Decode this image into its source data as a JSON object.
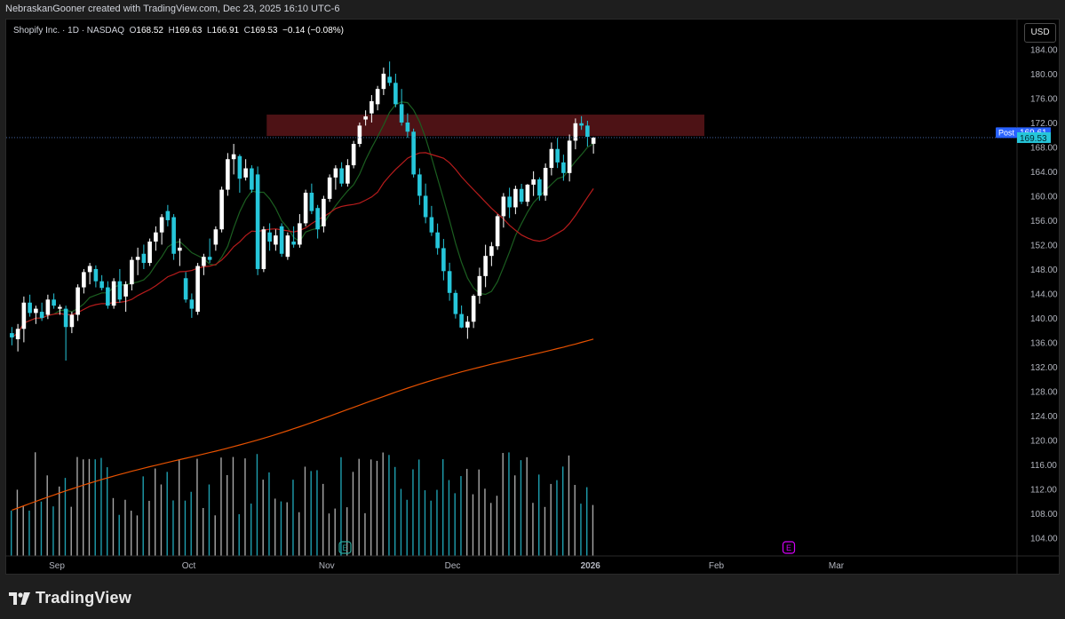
{
  "header": {
    "attribution": "NebraskanGooner created with TradingView.com, Dec 23, 2025 16:10 UTC-6"
  },
  "legend": {
    "symbol": "Shopify Inc. · 1D · NASDAQ",
    "o_label": "O",
    "o_value": "168.52",
    "h_label": "H",
    "h_value": "169.63",
    "l_label": "L",
    "l_value": "166.91",
    "c_label": "C",
    "c_value": "169.53",
    "change": "−0.14 (−0.08%)"
  },
  "toolbar": {
    "currency": "USD"
  },
  "price_badges": {
    "post_label": "Post",
    "post_value": "169.61",
    "last_value": "169.53"
  },
  "footer": {
    "brand": "TradingView"
  },
  "colors": {
    "up": "#ffffff",
    "down": "#26c6da",
    "ema_short": "#1b5e20",
    "ema_mid": "#b71c1c",
    "sma_long": "#e65100",
    "zone": "#5a1519",
    "post_badge": "#2962ff",
    "last_badge": "#26c6da",
    "earnings_icon": "#d500f9"
  },
  "chart_data": {
    "type": "candlestick",
    "symbol": "Shopify Inc.",
    "interval": "1D",
    "exchange": "NASDAQ",
    "currency": "USD",
    "ylim": [
      101,
      188
    ],
    "y_ticks": [
      184,
      180,
      176,
      172,
      168,
      164,
      160,
      156,
      152,
      148,
      144,
      140,
      136,
      132,
      128,
      124,
      120,
      116,
      112,
      108,
      104
    ],
    "x_axis_labels": [
      {
        "label": "Sep",
        "index": 8
      },
      {
        "label": "Oct",
        "index": 30
      },
      {
        "label": "Nov",
        "index": 53
      },
      {
        "label": "Dec",
        "index": 74
      },
      {
        "label": "2026",
        "index": 97
      },
      {
        "label": "Feb",
        "index": 118
      },
      {
        "label": "Mar",
        "index": 138
      }
    ],
    "x_count": 146,
    "grid": false,
    "resistance_zone": {
      "from_index": 43,
      "to_index": 116,
      "low": 169.8,
      "high": 173.3
    },
    "post_market_price": 169.61,
    "last_price": 169.53,
    "earnings_markers": [
      56,
      130
    ],
    "candles": [
      {
        "o": 137.5,
        "h": 138.5,
        "l": 135.5,
        "c": 136.8
      },
      {
        "o": 136.5,
        "h": 139.0,
        "l": 134.5,
        "c": 138.2
      },
      {
        "o": 138.2,
        "h": 143.5,
        "l": 136.0,
        "c": 142.5
      },
      {
        "o": 142.5,
        "h": 143.8,
        "l": 140.2,
        "c": 140.8
      },
      {
        "o": 140.8,
        "h": 142.0,
        "l": 139.0,
        "c": 141.5
      },
      {
        "o": 141.0,
        "h": 142.5,
        "l": 139.5,
        "c": 140.0
      },
      {
        "o": 140.5,
        "h": 143.8,
        "l": 139.8,
        "c": 143.0
      },
      {
        "o": 143.0,
        "h": 144.0,
        "l": 141.5,
        "c": 142.0
      },
      {
        "o": 141.5,
        "h": 142.2,
        "l": 140.5,
        "c": 141.8
      },
      {
        "o": 141.5,
        "h": 142.0,
        "l": 133.0,
        "c": 138.5
      },
      {
        "o": 138.5,
        "h": 141.0,
        "l": 137.5,
        "c": 140.5
      },
      {
        "o": 140.5,
        "h": 145.5,
        "l": 139.5,
        "c": 145.0
      },
      {
        "o": 145.0,
        "h": 148.0,
        "l": 144.0,
        "c": 147.5
      },
      {
        "o": 147.5,
        "h": 149.0,
        "l": 145.5,
        "c": 148.5
      },
      {
        "o": 148.0,
        "h": 148.6,
        "l": 145.0,
        "c": 146.0
      },
      {
        "o": 146.0,
        "h": 147.0,
        "l": 144.5,
        "c": 144.9
      },
      {
        "o": 145.0,
        "h": 146.0,
        "l": 141.5,
        "c": 142.0
      },
      {
        "o": 142.0,
        "h": 146.5,
        "l": 141.5,
        "c": 146.0
      },
      {
        "o": 146.0,
        "h": 148.0,
        "l": 142.5,
        "c": 143.0
      },
      {
        "o": 143.5,
        "h": 146.0,
        "l": 141.0,
        "c": 145.5
      },
      {
        "o": 145.5,
        "h": 150.0,
        "l": 144.5,
        "c": 149.5
      },
      {
        "o": 149.5,
        "h": 151.5,
        "l": 147.0,
        "c": 150.0
      },
      {
        "o": 150.5,
        "h": 152.0,
        "l": 148.0,
        "c": 149.0
      },
      {
        "o": 149.0,
        "h": 153.0,
        "l": 148.5,
        "c": 152.5
      },
      {
        "o": 152.5,
        "h": 155.0,
        "l": 151.0,
        "c": 154.0
      },
      {
        "o": 154.0,
        "h": 157.0,
        "l": 152.0,
        "c": 156.5
      },
      {
        "o": 157.5,
        "h": 158.5,
        "l": 155.0,
        "c": 156.0
      },
      {
        "o": 156.5,
        "h": 157.0,
        "l": 149.5,
        "c": 150.5
      },
      {
        "o": 151.0,
        "h": 153.0,
        "l": 148.5,
        "c": 151.5
      },
      {
        "o": 146.5,
        "h": 147.5,
        "l": 142.5,
        "c": 143.0
      },
      {
        "o": 143.0,
        "h": 144.0,
        "l": 140.0,
        "c": 141.5
      },
      {
        "o": 141.0,
        "h": 149.0,
        "l": 140.5,
        "c": 148.5
      },
      {
        "o": 148.5,
        "h": 150.5,
        "l": 147.0,
        "c": 150.0
      },
      {
        "o": 150.0,
        "h": 153.0,
        "l": 149.0,
        "c": 149.5
      },
      {
        "o": 152.0,
        "h": 155.0,
        "l": 151.0,
        "c": 154.5
      },
      {
        "o": 154.5,
        "h": 161.5,
        "l": 154.0,
        "c": 161.0
      },
      {
        "o": 161.0,
        "h": 167.0,
        "l": 160.0,
        "c": 166.0
      },
      {
        "o": 166.0,
        "h": 168.5,
        "l": 163.5,
        "c": 166.8
      },
      {
        "o": 166.5,
        "h": 166.8,
        "l": 160.5,
        "c": 162.8
      },
      {
        "o": 163.0,
        "h": 166.0,
        "l": 162.5,
        "c": 164.5
      },
      {
        "o": 164.5,
        "h": 165.0,
        "l": 160.5,
        "c": 161.0
      },
      {
        "o": 163.5,
        "h": 164.8,
        "l": 147.0,
        "c": 148.0
      },
      {
        "o": 148.0,
        "h": 155.0,
        "l": 147.5,
        "c": 154.5
      },
      {
        "o": 154.0,
        "h": 155.5,
        "l": 151.0,
        "c": 152.5
      },
      {
        "o": 152.0,
        "h": 154.5,
        "l": 151.0,
        "c": 153.5
      },
      {
        "o": 155.0,
        "h": 155.5,
        "l": 150.0,
        "c": 150.5
      },
      {
        "o": 150.0,
        "h": 154.0,
        "l": 149.5,
        "c": 153.5
      },
      {
        "o": 152.5,
        "h": 155.0,
        "l": 151.5,
        "c": 152.0
      },
      {
        "o": 152.0,
        "h": 157.0,
        "l": 151.5,
        "c": 155.5
      },
      {
        "o": 155.5,
        "h": 161.0,
        "l": 155.0,
        "c": 160.5
      },
      {
        "o": 160.5,
        "h": 162.0,
        "l": 157.0,
        "c": 157.5
      },
      {
        "o": 158.0,
        "h": 158.5,
        "l": 153.0,
        "c": 154.5
      },
      {
        "o": 155.0,
        "h": 160.0,
        "l": 154.0,
        "c": 159.5
      },
      {
        "o": 159.5,
        "h": 163.5,
        "l": 159.0,
        "c": 163.0
      },
      {
        "o": 163.0,
        "h": 165.0,
        "l": 161.0,
        "c": 164.5
      },
      {
        "o": 164.5,
        "h": 165.5,
        "l": 161.5,
        "c": 162.0
      },
      {
        "o": 162.0,
        "h": 166.0,
        "l": 161.5,
        "c": 165.0
      },
      {
        "o": 165.0,
        "h": 169.0,
        "l": 164.5,
        "c": 168.5
      },
      {
        "o": 168.5,
        "h": 172.0,
        "l": 168.0,
        "c": 171.5
      },
      {
        "o": 172.5,
        "h": 174.0,
        "l": 171.5,
        "c": 173.0
      },
      {
        "o": 173.5,
        "h": 176.5,
        "l": 172.0,
        "c": 175.5
      },
      {
        "o": 175.0,
        "h": 178.0,
        "l": 174.0,
        "c": 177.5
      },
      {
        "o": 177.5,
        "h": 181.0,
        "l": 176.5,
        "c": 180.0
      },
      {
        "o": 179.5,
        "h": 182.0,
        "l": 178.0,
        "c": 178.5
      },
      {
        "o": 178.5,
        "h": 180.0,
        "l": 174.5,
        "c": 175.0
      },
      {
        "o": 175.0,
        "h": 177.5,
        "l": 171.5,
        "c": 172.0
      },
      {
        "o": 172.0,
        "h": 173.5,
        "l": 169.5,
        "c": 170.5
      },
      {
        "o": 170.5,
        "h": 171.0,
        "l": 163.0,
        "c": 163.5
      },
      {
        "o": 163.5,
        "h": 164.5,
        "l": 158.5,
        "c": 160.0
      },
      {
        "o": 160.0,
        "h": 162.0,
        "l": 155.5,
        "c": 156.5
      }
    ],
    "ema_short": [],
    "ema_mid": [],
    "sma_long": [],
    "volume": []
  }
}
